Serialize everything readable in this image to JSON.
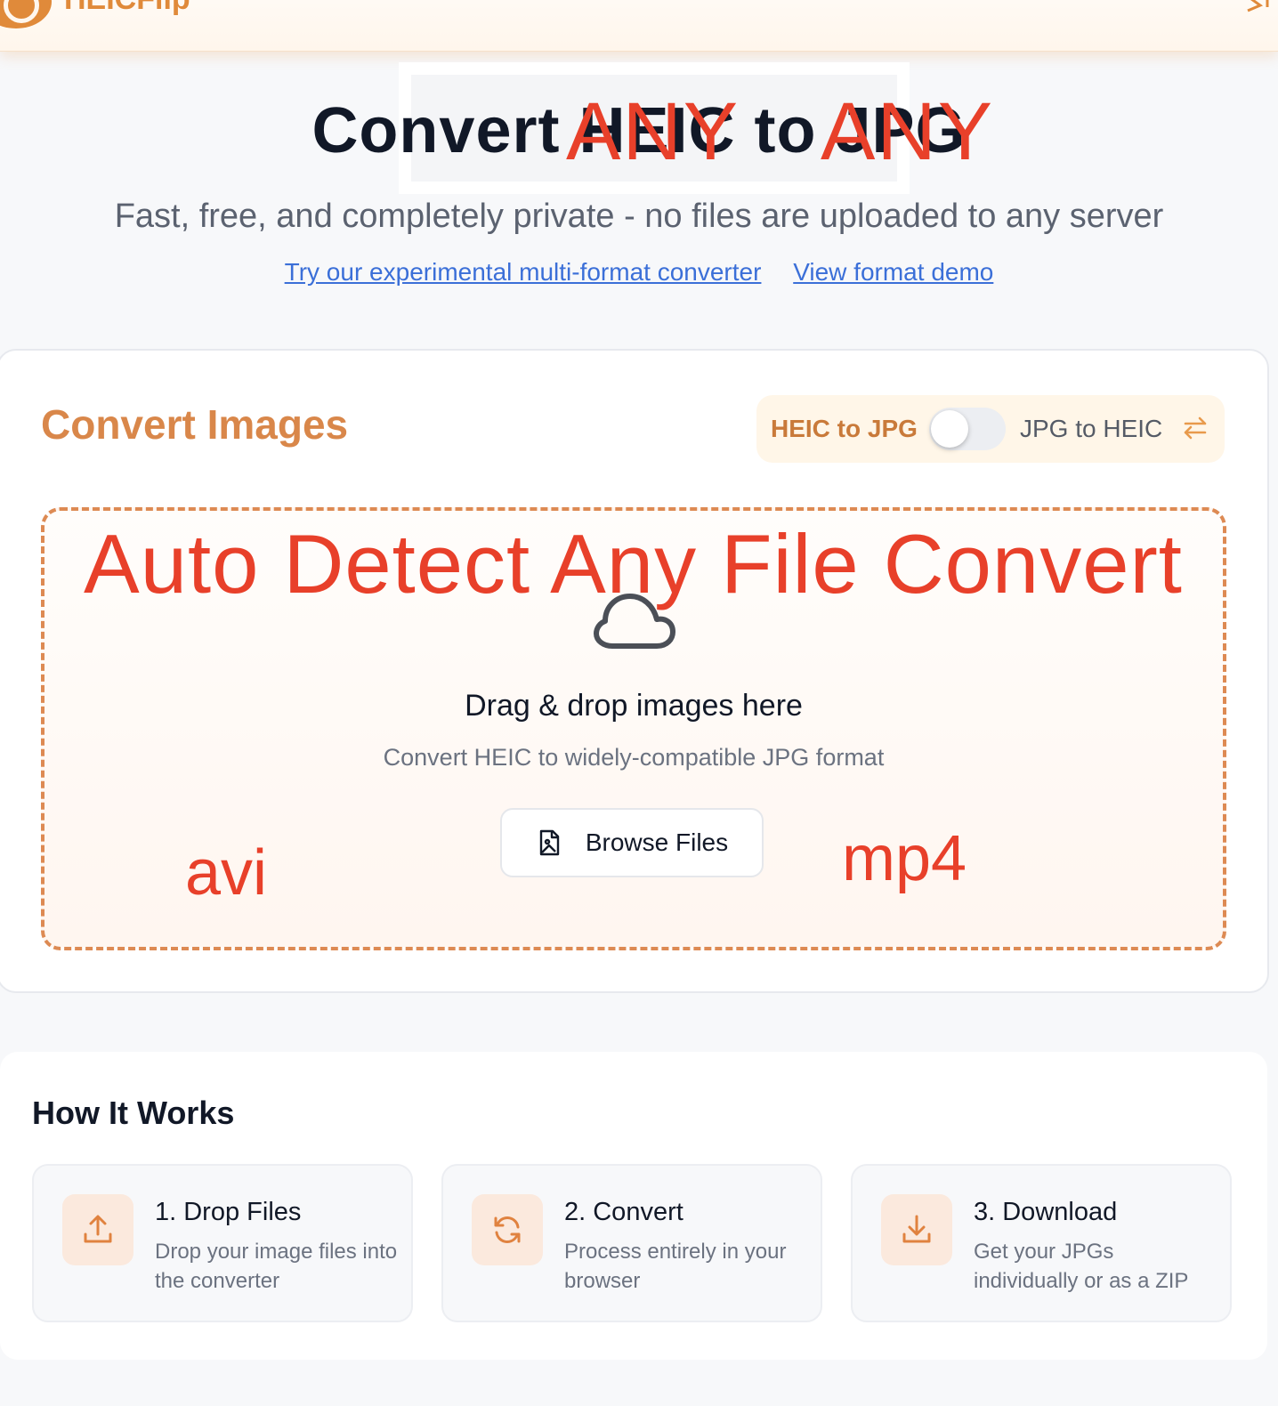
{
  "header": {
    "brand": "HEICFlip"
  },
  "hero": {
    "title": "Convert HEIC to JPG",
    "overlay_left": "ANY",
    "overlay_right": "ANY",
    "subtitle": "Fast, free, and completely private - no files are uploaded to any server",
    "link_converter": "Try our experimental multi-format converter",
    "link_demo": "View format demo"
  },
  "converter": {
    "title": "Convert Images",
    "mode_left": "HEIC to JPG",
    "mode_right": "JPG to HEIC",
    "toggle_on": false,
    "dropzone": {
      "overlay_text": "Auto Detect Any File Convert",
      "title": "Drag & drop images here",
      "subtitle": "Convert HEIC to widely-compatible JPG format",
      "button_label": "Browse Files",
      "overlay_left": "avi",
      "overlay_right": "mp4"
    }
  },
  "how_it_works": {
    "title": "How It Works",
    "steps": [
      {
        "title": "1. Drop Files",
        "desc": "Drop your image files into the converter",
        "icon": "upload-icon"
      },
      {
        "title": "2. Convert",
        "desc": "Process entirely in your browser",
        "icon": "refresh-icon"
      },
      {
        "title": "3. Download",
        "desc": "Get your JPGs individually or as a ZIP",
        "icon": "download-icon"
      }
    ]
  },
  "colors": {
    "accent": "#e08a3a",
    "annotation_red": "#e8402a",
    "link_blue": "#3b6fd8"
  }
}
